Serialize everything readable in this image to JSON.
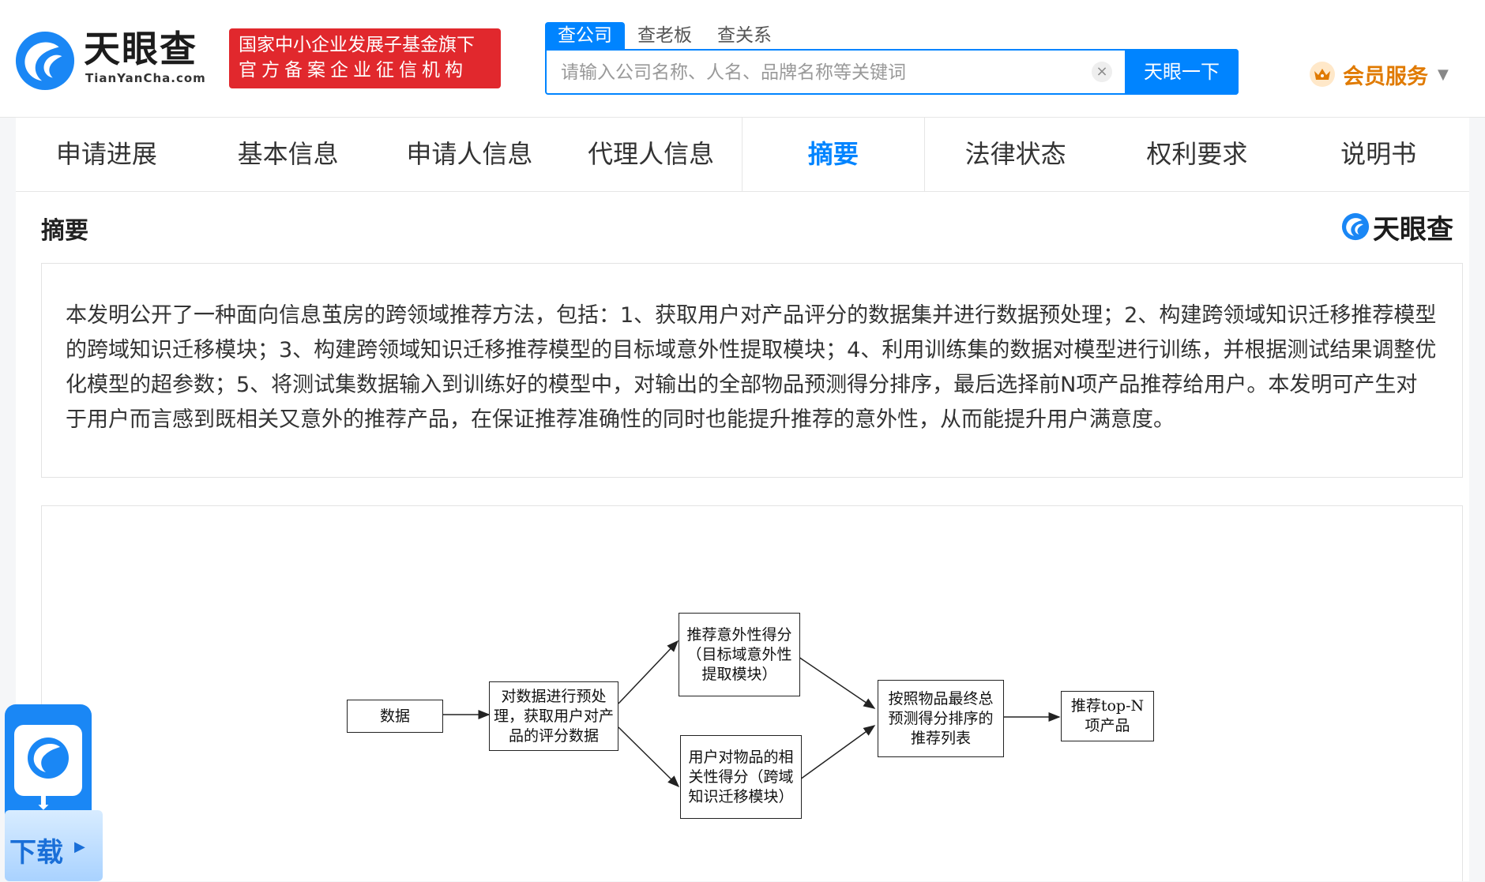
{
  "header": {
    "logo_text": "天眼查",
    "logo_sub": "TianYanCha.com",
    "badge_line1": "国家中小企业发展子基金旗下",
    "badge_line2": "官方备案企业征信机构",
    "search_tabs": [
      "查公司",
      "查老板",
      "查关系"
    ],
    "search_placeholder": "请输入公司名称、人名、品牌名称等关键词",
    "clear_symbol": "×",
    "search_button": "天眼一下",
    "vip_label": "会员服务",
    "vip_caret": "▼"
  },
  "tabs": [
    "申请进展",
    "基本信息",
    "申请人信息",
    "代理人信息",
    "摘要",
    "法律状态",
    "权利要求",
    "说明书"
  ],
  "section": {
    "title": "摘要",
    "logo_text": "天眼查",
    "abstract": "本发明公开了一种面向信息茧房的跨领域推荐方法，包括：1、获取用户对产品评分的数据集并进行数据预处理；2、构建跨领域知识迁移推荐模型的跨域知识迁移模块；3、构建跨领域知识迁移推荐模型的目标域意外性提取模块；4、利用训练集的数据对模型进行训练，并根据测试结果调整优化模型的超参数；5、将测试集数据输入到训练好的模型中，对输出的全部物品预测得分排序，最后选择前N项产品推荐给用户。本发明可产生对于用户而言感到既相关又意外的推荐产品，在保证推荐准确性的同时也能提升推荐的意外性，从而能提升用户满意度。"
  },
  "figure": {
    "boxes": {
      "data": "数据",
      "preprocess": "对数据进行预处理，获取用户对产品的评分数据",
      "unexpected": "推荐意外性得分（目标域意外性提取模块）",
      "relevance": "用户对物品的相关性得分（跨域知识迁移模块）",
      "rank": "按照物品最终总预测得分排序的推荐列表",
      "topn": "推荐top-N项产品"
    }
  },
  "download": {
    "label": "下载",
    "play": "▶",
    "arrow": "⬇"
  }
}
